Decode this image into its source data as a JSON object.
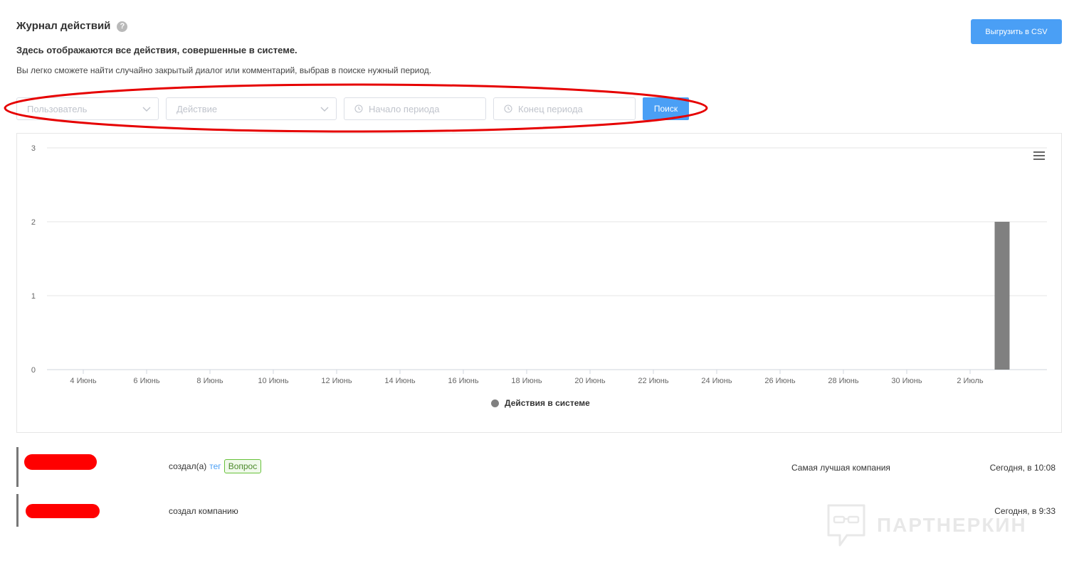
{
  "header": {
    "title": "Журнал действий",
    "help_symbol": "?",
    "subtitle": "Здесь отображаются все действия, совершенные в системе.",
    "description": "Вы легко сможете найти случайно закрытый диалог или комментарий, выбрав в поиске нужный период.",
    "export_label": "Выгрузить в CSV"
  },
  "filters": {
    "user_placeholder": "Пользователь",
    "action_placeholder": "Действие",
    "start_placeholder": "Начало периода",
    "end_placeholder": "Конец периода",
    "search_label": "Поиск"
  },
  "colors": {
    "accent": "#4a9ff5",
    "bar": "#808080",
    "annotation": "#e60000",
    "tag_green": "#67c23a"
  },
  "chart_data": {
    "type": "bar",
    "title": "",
    "xlabel": "",
    "ylabel": "",
    "x_tick_labels": [
      "4 Июнь",
      "6 Июнь",
      "8 Июнь",
      "10 Июнь",
      "12 Июнь",
      "14 Июнь",
      "16 Июнь",
      "18 Июнь",
      "20 Июнь",
      "22 Июнь",
      "24 Июнь",
      "26 Июнь",
      "28 Июнь",
      "30 Июнь",
      "2 Июль"
    ],
    "y_ticks": [
      0,
      1,
      2,
      3
    ],
    "ylim": [
      0,
      3
    ],
    "grid": true,
    "legend_position": "bottom-center",
    "series": [
      {
        "name": "Действия в системе",
        "color": "#808080",
        "points": [
          {
            "x": "3 Июль",
            "y": 2
          }
        ]
      }
    ]
  },
  "log": [
    {
      "action": "создал(а)",
      "link": "тег",
      "tag": "Вопрос",
      "company": "Самая лучшая компания",
      "time": "Сегодня, в 10:08"
    },
    {
      "action": "создал компанию",
      "time": "Сегодня, в 9:33"
    }
  ],
  "watermark": {
    "text": "ПАРТНЕРКИН"
  }
}
